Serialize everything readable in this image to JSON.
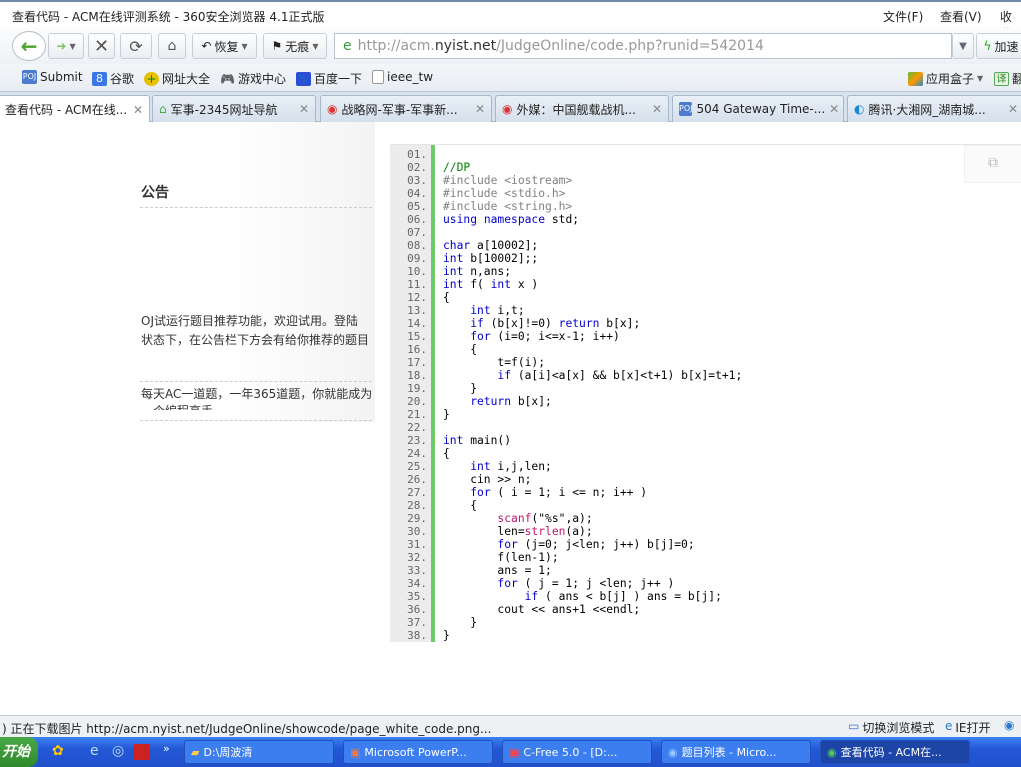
{
  "window": {
    "title": "查看代码 - ACM在线评测系统 - 360安全浏览器 4.1正式版",
    "menus": [
      "文件(F)",
      "查看(V)",
      "收藏"
    ]
  },
  "toolbar": {
    "restore": "恢复",
    "incognito": "无痕",
    "url_prefix": "http://acm.",
    "url_domain": "nyist.net",
    "url_path": "/JudgeOnline/code.php?runid=542014",
    "accelerate": "加速"
  },
  "bookmarks": [
    {
      "label": "Submit",
      "icon": "POJ"
    },
    {
      "label": "谷歌",
      "icon": "8"
    },
    {
      "label": "网址大全",
      "icon": "+"
    },
    {
      "label": "游戏中心",
      "icon": "gamepad"
    },
    {
      "label": "百度一下",
      "icon": "paw"
    },
    {
      "label": "ieee_tw",
      "icon": "page"
    }
  ],
  "bookmarks_right": {
    "appbox": "应用盒子",
    "translate": "译",
    "translate_more": "翻"
  },
  "tabs": [
    {
      "label": "查看代码 - ACM在线..."
    },
    {
      "label": "军事-2345网址导航"
    },
    {
      "label": "战略网-军事-军事新..."
    },
    {
      "label": "外媒：中国舰载战机..."
    },
    {
      "label": "504 Gateway Time-..."
    },
    {
      "label": "腾讯·大湘网_湖南城..."
    }
  ],
  "sidebar": {
    "heading": "公告",
    "notice1_l1": "OJ试运行题目推荐功能，欢迎试用。登陆",
    "notice1_l2": "状态下，在公告栏下方会有给你推荐的题目",
    "notice2_l1": "每天AC一道题，一年365道题，你就能成为",
    "notice2_l2": "一个编程高手"
  },
  "code": {
    "lines": [
      "",
      "//DP",
      "#include <iostream>",
      "#include <stdio.h>",
      "#include <string.h>",
      "using namespace std;",
      "",
      "char a[10002];",
      "int b[10002];;",
      "int n,ans;",
      "int f( int x )",
      "{",
      "    int i,t;",
      "    if (b[x]!=0) return b[x];",
      "    for (i=0; i<=x-1; i++)",
      "    {",
      "        t=f(i);",
      "        if (a[i]<a[x] && b[x]<t+1) b[x]=t+1;",
      "    }",
      "    return b[x];",
      "}",
      "",
      "int main()",
      "{",
      "    int i,j,len;",
      "    cin >> n;",
      "    for ( i = 1; i <= n; i++ )",
      "    {",
      "        scanf(\"%s\",a);",
      "        len=strlen(a);",
      "        for (j=0; j<len; j++) b[j]=0;",
      "        f(len-1);",
      "        ans = 1;",
      "        for ( j = 1; j <len; j++ )",
      "            if ( ans < b[j] ) ans = b[j];",
      "        cout << ans+1 <<endl;",
      "    }",
      "}"
    ]
  },
  "status": {
    "text": ") 正在下载图片 http://acm.nyist.net/JudgeOnline/showcode/page_white_code.png...",
    "switch_mode": "切换浏览模式",
    "ie_open": "IE打开"
  },
  "taskbar": {
    "start": "开始",
    "tasks": [
      {
        "label": "D:\\周波清"
      },
      {
        "label": "Microsoft PowerP..."
      },
      {
        "label": "C-Free 5.0 - [D:..."
      },
      {
        "label": "题目列表 - Micro..."
      },
      {
        "label": "查看代码 - ACM在..."
      }
    ]
  }
}
